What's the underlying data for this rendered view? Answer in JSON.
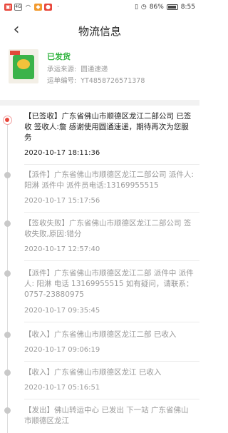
{
  "status_bar": {
    "battery": "86%",
    "time": "8:55"
  },
  "header": {
    "title": "物流信息"
  },
  "package": {
    "status": "已发货",
    "carrier_label": "承运来源:",
    "carrier_value": "圆通速递",
    "tracking_label": "运单编号:",
    "tracking_value": "YT4858726571378"
  },
  "timeline": [
    {
      "desc": "【已签收】广东省佛山市顺德区龙江二部公司 已签收 签收人:詹 感谢使用圆通速递，期待再次为您服务",
      "time": "2020-10-17 18:11:36"
    },
    {
      "desc": "【派件】广东省佛山市顺德区龙江二部公司 派件人:阳淋 派件中 派件员电话:13169955515",
      "time": "2020-10-17 15:17:56"
    },
    {
      "desc": "【签收失败】广东省佛山市顺德区龙江二部公司 签收失败,原因:错分",
      "time": "2020-10-17 12:57:40"
    },
    {
      "desc": "【派件】广东省佛山市顺德区龙江二部 派件中 派件人: 阳淋 电话 13169955515 如有疑问，请联系：0757-23880975",
      "time": "2020-10-17 09:35:45"
    },
    {
      "desc": "【收入】广东省佛山市顺德区龙江二部 已收入",
      "time": "2020-10-17 09:06:19"
    },
    {
      "desc": "【收入】广东省佛山市顺德区龙江 已收入",
      "time": "2020-10-17 05:16:51"
    },
    {
      "desc": "【发出】佛山转运中心 已发出 下一站 广东省佛山市顺德区龙江",
      "time": ""
    }
  ]
}
